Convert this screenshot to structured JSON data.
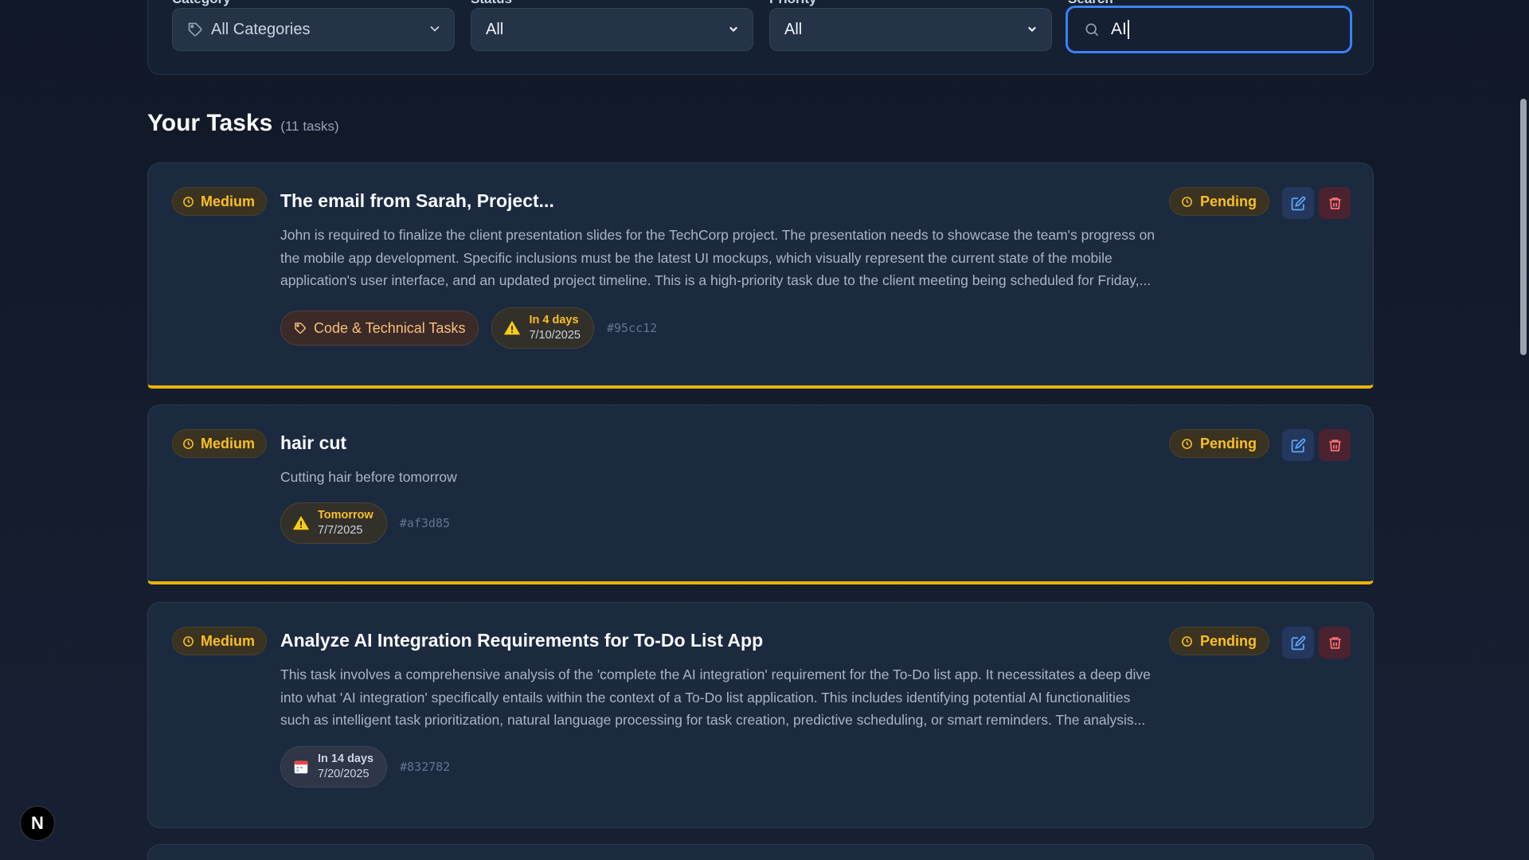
{
  "filters": {
    "category": {
      "label": "Category",
      "value": "All Categories"
    },
    "status": {
      "label": "Status",
      "value": "All"
    },
    "priority": {
      "label": "Priority",
      "value": "All"
    },
    "search": {
      "label": "Search",
      "value": "AI"
    }
  },
  "tasks_header": {
    "title": "Your Tasks",
    "count": "(11 tasks)"
  },
  "tasks": [
    {
      "priority": "Medium",
      "title": "The email from Sarah, Project...",
      "description": "John is required to finalize the client presentation slides for the TechCorp project. The presentation needs to showcase the team's progress on the mobile app development. Specific inclusions must be the latest UI mockups, which visually represent the current state of the mobile application's user interface, and an updated project timeline. This is a high-priority task due to the client meeting being scheduled for Friday,...",
      "status": "Pending",
      "category": "Code & Technical Tasks",
      "due_relative": "In 4 days",
      "due_date": "7/10/2025",
      "id": "#95cc12"
    },
    {
      "priority": "Medium",
      "title": "hair cut",
      "description": "Cutting hair before tomorrow",
      "status": "Pending",
      "due_relative": "Tomorrow",
      "due_date": "7/7/2025",
      "id": "#af3d85"
    },
    {
      "priority": "Medium",
      "title": "Analyze AI Integration Requirements for To-Do List App",
      "description": "This task involves a comprehensive analysis of the 'complete the AI integration' requirement for the To-Do list app. It necessitates a deep dive into what 'AI integration' specifically entails within the context of a To-Do list application. This includes identifying potential AI functionalities such as intelligent task prioritization, natural language processing for task creation, predictive scheduling, or smart reminders. The analysis...",
      "status": "Pending",
      "due_relative": "In 14 days",
      "due_date": "7/20/2025",
      "id": "#832782"
    }
  ],
  "colors": {
    "accent": "#3b82f6",
    "medium": "#fbbf24",
    "border_medium": "#eab308",
    "danger": "#ef4444"
  },
  "logo": "N"
}
